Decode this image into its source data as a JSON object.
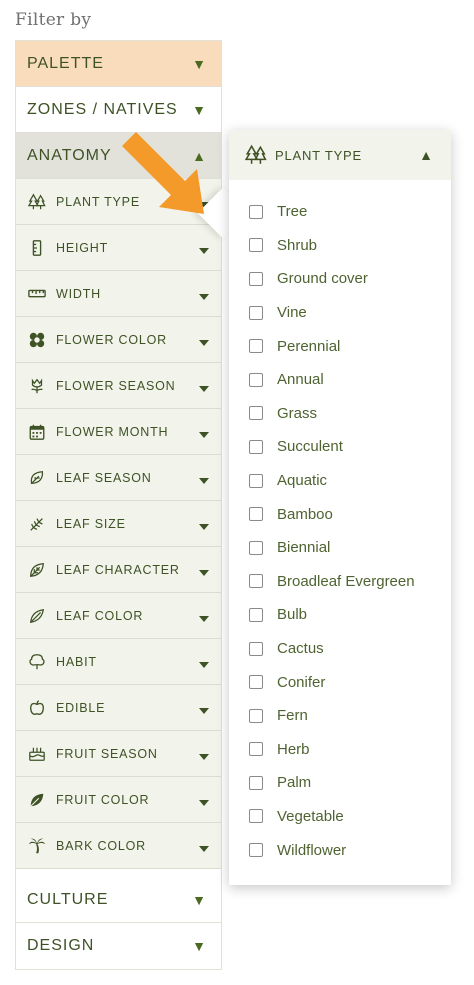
{
  "filter": {
    "title": "Filter by"
  },
  "sections": {
    "palette": "PALETTE",
    "zones": "ZONES / NATIVES",
    "anatomy": "ANATOMY",
    "culture": "CULTURE",
    "design": "DESIGN"
  },
  "anatomy_items": [
    {
      "label": "PLANT TYPE",
      "icon": "trees-icon"
    },
    {
      "label": "HEIGHT",
      "icon": "height-icon"
    },
    {
      "label": "WIDTH",
      "icon": "ruler-icon"
    },
    {
      "label": "FLOWER COLOR",
      "icon": "flower-icon"
    },
    {
      "label": "FLOWER SEASON",
      "icon": "blossom-icon"
    },
    {
      "label": "FLOWER MONTH",
      "icon": "calendar-icon"
    },
    {
      "label": "LEAF SEASON",
      "icon": "leaf-outline-icon"
    },
    {
      "label": "LEAF SIZE",
      "icon": "fern-leaf-icon"
    },
    {
      "label": "LEAF CHARACTER",
      "icon": "leaf-vein-icon"
    },
    {
      "label": "LEAF COLOR",
      "icon": "leaf-icon"
    },
    {
      "label": "HABIT",
      "icon": "tree-outline-icon"
    },
    {
      "label": "EDIBLE",
      "icon": "apple-icon"
    },
    {
      "label": "FRUIT SEASON",
      "icon": "cake-icon"
    },
    {
      "label": "FRUIT COLOR",
      "icon": "filled-leaf-icon"
    },
    {
      "label": "BARK COLOR",
      "icon": "palm-icon"
    }
  ],
  "plant_type_panel": {
    "title": "PLANT TYPE",
    "options": [
      "Tree",
      "Shrub",
      "Ground cover",
      "Vine",
      "Perennial",
      "Annual",
      "Grass",
      "Succulent",
      "Aquatic",
      "Bamboo",
      "Biennial",
      "Broadleaf Evergreen",
      "Bulb",
      "Cactus",
      "Conifer",
      "Fern",
      "Herb",
      "Palm",
      "Vegetable",
      "Wildflower"
    ]
  },
  "colors": {
    "accent_green": "#3e5226",
    "palette_bg": "#f9dcbc",
    "arrow_orange": "#f39a2b"
  }
}
